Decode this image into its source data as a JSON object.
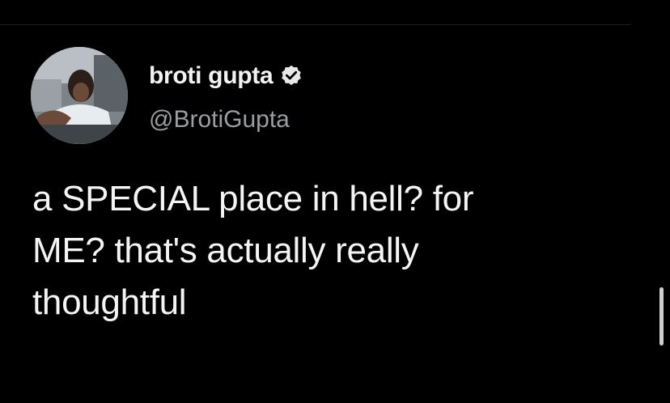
{
  "tweet": {
    "author": {
      "display_name": "broti gupta",
      "handle": "@BrotiGupta",
      "verified": true,
      "verified_icon": "verified-badge-icon",
      "avatar": "profile-photo"
    },
    "text_lines": [
      "a SPECIAL place in hell? for",
      "ME? that's actually really",
      "thoughtful"
    ]
  },
  "colors": {
    "background": "#000000",
    "name": "#f2f2f2",
    "handle": "#9a9ea3",
    "body_text": "#f4f4f4"
  }
}
